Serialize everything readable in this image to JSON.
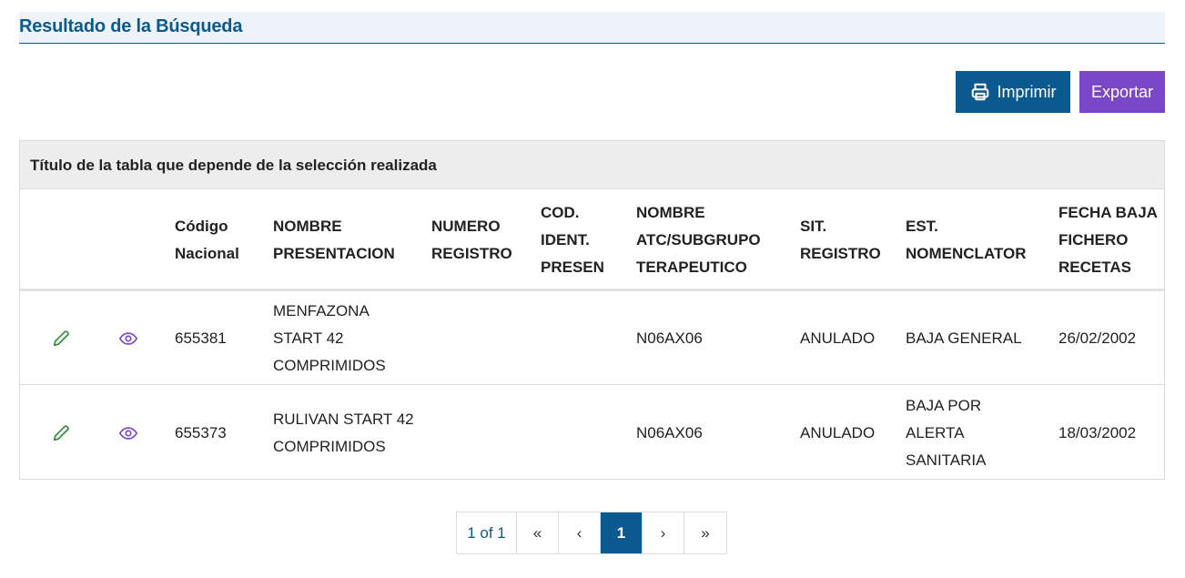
{
  "section": {
    "title": "Resultado de la Búsqueda"
  },
  "toolbar": {
    "print_label": "Imprimir",
    "export_label": "Exportar",
    "print_icon": "printer-icon"
  },
  "table": {
    "caption": "Título de la tabla que depende de la selección realizada",
    "columns": [
      "Código Nacional",
      "NOMBRE PRESENTACION",
      "NUMERO REGISTRO",
      "COD. IDENT. PRESEN",
      "NOMBRE ATC/SUBGRUPO TERAPEUTICO",
      "SIT. REGISTRO",
      "EST. NOMENCLATOR",
      "FECHA BAJA FICHERO RECETAS"
    ],
    "rows": [
      {
        "codigo": "655381",
        "nombre": "MENFAZONA START 42 COMPRIMIDOS",
        "numero_registro": "",
        "cod_ident": "",
        "atc": "N06AX06",
        "sit_registro": "ANULADO",
        "est_nomenclator": "BAJA GENERAL",
        "fecha_baja": "26/02/2002"
      },
      {
        "codigo": "655373",
        "nombre": "RULIVAN START 42 COMPRIMIDOS",
        "numero_registro": "",
        "cod_ident": "",
        "atc": "N06AX06",
        "sit_registro": "ANULADO",
        "est_nomenclator": "BAJA POR ALERTA SANITARIA",
        "fecha_baja": "18/03/2002"
      }
    ],
    "row_icons": {
      "edit": "pencil-icon",
      "view": "eye-icon"
    }
  },
  "pagination": {
    "info": "1 of 1",
    "first": "«",
    "prev": "‹",
    "current": "1",
    "next": "›",
    "last": "»"
  },
  "colors": {
    "primary": "#0b5a8f",
    "export": "#7b47c9",
    "edit_icon": "#2e8b3d",
    "view_icon": "#7b47c9"
  }
}
